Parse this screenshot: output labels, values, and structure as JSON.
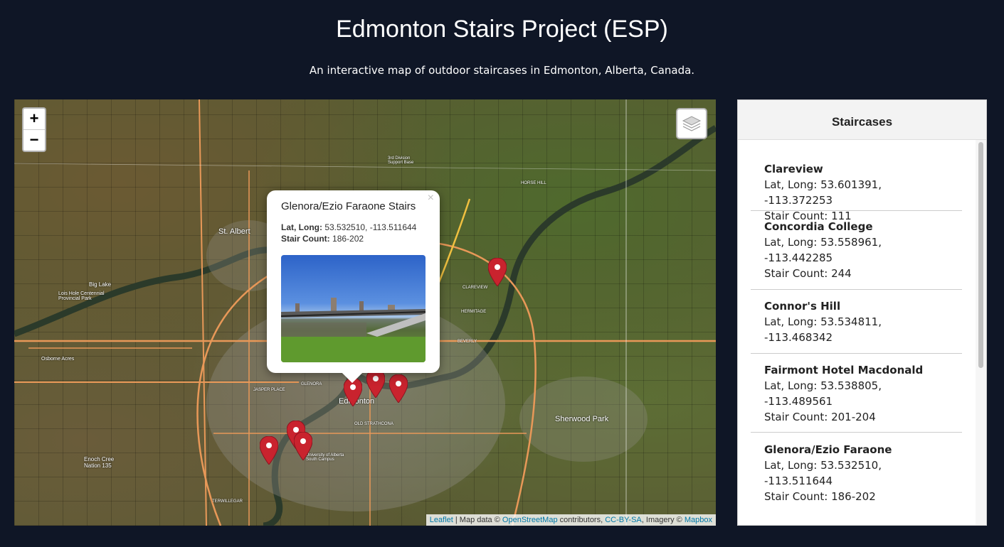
{
  "page": {
    "title": "Edmonton Stairs Project (ESP)",
    "subtitle": "An interactive map of outdoor staircases in Edmonton, Alberta, Canada."
  },
  "map": {
    "zoom_in": "+",
    "zoom_out": "−",
    "layers_icon": "layers-icon",
    "labels": {
      "st_albert": "St. Albert",
      "edmonton": "Edmonton",
      "sherwood_park": "Sherwood Park",
      "big_lake": "Big Lake",
      "lois_hole": "Lois Hole Centennial Provincial Park",
      "osborne": "Osborne Acres",
      "enoch": "Enoch Cree Nation 135",
      "third_div": "3rd Division Support Base",
      "horse_hill": "HORSE HILL",
      "clareview": "CLAREVIEW",
      "strathcona": "OLD STRATHCONA",
      "uofa": "University of Alberta South Campus",
      "hermitage": "HERMITAGE",
      "beverly": "BEVERLY",
      "terwillegar": "TERWILLEGAR",
      "jasper": "JASPER PLACE",
      "glenora": "GLENORA"
    },
    "popup": {
      "close": "×",
      "title": "Glenora/Ezio Faraone Stairs",
      "latlong_label": "Lat, Long:",
      "latlong_value": "53.532510, -113.511644",
      "stair_label": "Stair Count:",
      "stair_value": "186-202"
    },
    "attribution": {
      "leaflet": "Leaflet",
      "map_data": "| Map data ©",
      "osm": "OpenStreetMap",
      "contributors": "contributors,",
      "license": "CC-BY-SA",
      "imagery": ", Imagery ©",
      "mapbox": "Mapbox"
    }
  },
  "sidebar": {
    "title": "Staircases",
    "items": [
      {
        "name": "Clareview",
        "latlong": "Lat, Long: 53.601391,",
        "long2": "-113.372253",
        "count": "Stair Count: 111"
      },
      {
        "name": "Concordia College",
        "latlong": "Lat, Long: 53.558961,",
        "long2": "-113.442285",
        "count": "Stair Count: 244"
      },
      {
        "name": "Connor's Hill",
        "latlong": "Lat, Long: 53.534811,",
        "long2": "-113.468342",
        "count": ""
      },
      {
        "name": "Fairmont Hotel Macdonald",
        "latlong": "Lat, Long: 53.538805,",
        "long2": "-113.489561",
        "count": "Stair Count: 201-204"
      },
      {
        "name": "Glenora/Ezio Faraone",
        "latlong": "Lat, Long: 53.532510,",
        "long2": "-113.511644",
        "count": "Stair Count: 186-202"
      }
    ]
  }
}
